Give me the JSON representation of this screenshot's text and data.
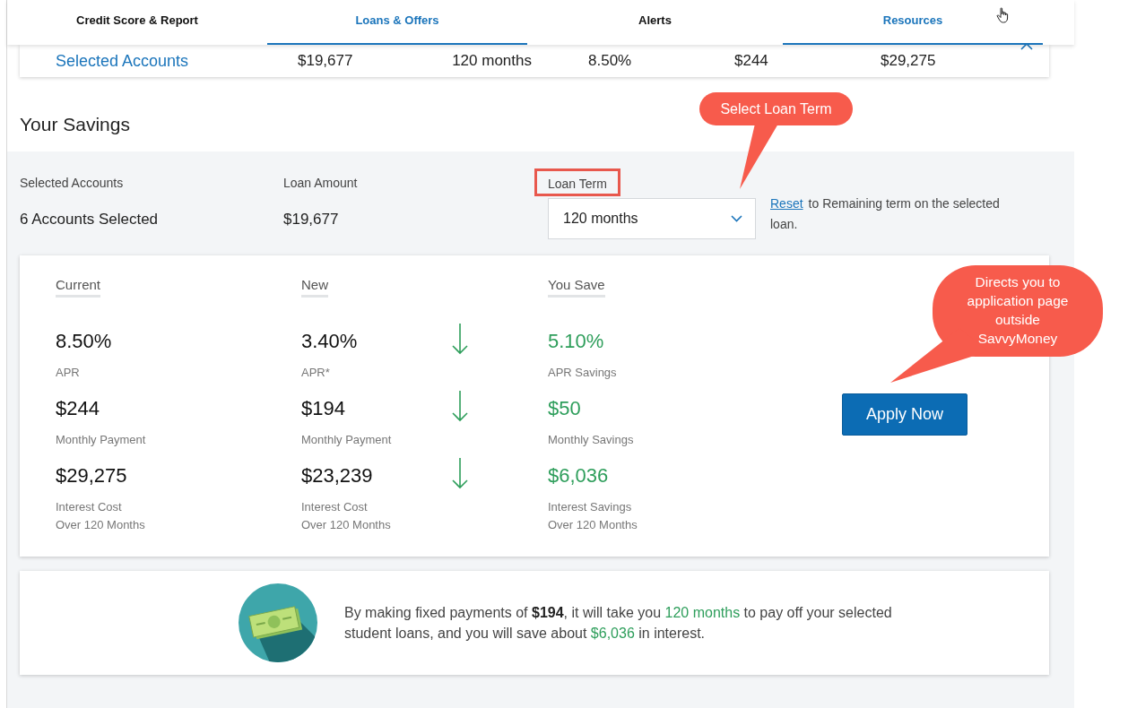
{
  "nav": {
    "tabs": [
      {
        "label": "Credit Score & Report",
        "selected": false
      },
      {
        "label": "Loans & Offers",
        "selected": true
      },
      {
        "label": "Alerts",
        "selected": false
      },
      {
        "label": "Resources",
        "selected": true
      }
    ]
  },
  "summary": {
    "label": "Selected Accounts",
    "values": [
      "$19,677",
      "120 months",
      "8.50%",
      "$244",
      "$29,275"
    ]
  },
  "savings": {
    "title": "Your Savings",
    "fields": [
      {
        "label": "Selected Accounts",
        "value": "6 Accounts Selected"
      },
      {
        "label": "Loan Amount",
        "value": "$19,677"
      }
    ],
    "loan_term": {
      "label": "Loan Term",
      "value": "120 months",
      "highlighted": true
    },
    "reset": {
      "link": "Reset",
      "text": "to Remaining term on the selected loan."
    }
  },
  "comparison": {
    "headings": [
      "Current",
      "New",
      "You Save"
    ],
    "rows": [
      {
        "current": {
          "value": "8.50%",
          "label": "APR"
        },
        "new": {
          "value": "3.40%",
          "label": "APR*"
        },
        "decreased": true,
        "savings": {
          "value": "5.10%",
          "label": "APR Savings"
        }
      },
      {
        "current": {
          "value": "$244",
          "label": "Monthly Payment"
        },
        "new": {
          "value": "$194",
          "label": "Monthly Payment"
        },
        "decreased": true,
        "savings": {
          "value": "$50",
          "label": "Monthly Savings"
        }
      },
      {
        "current": {
          "value": "$29,275",
          "label": "Interest Cost\nOver 120 Months"
        },
        "new": {
          "value": "$23,239",
          "label": "Interest Cost\nOver 120 Months"
        },
        "decreased": true,
        "savings": {
          "value": "$6,036",
          "label": "Interest Savings\nOver 120 Months"
        }
      }
    ],
    "apply_button": "Apply Now"
  },
  "note": {
    "segments": [
      {
        "text": "By making fixed payments of ",
        "kind": "plain"
      },
      {
        "text": "$194",
        "kind": "bold"
      },
      {
        "text": ", it will take you ",
        "kind": "plain"
      },
      {
        "text": "120 months",
        "kind": "green"
      },
      {
        "text": " to pay off your selected student loans, and you will save about ",
        "kind": "plain"
      },
      {
        "text": "$6,036",
        "kind": "green"
      },
      {
        "text": " in interest.",
        "kind": "plain"
      }
    ]
  },
  "annotations": [
    {
      "text": "Select Loan Term",
      "kind": "pill"
    },
    {
      "text": "Directs you to application page outside SavvyMoney",
      "kind": "bubble"
    }
  ]
}
